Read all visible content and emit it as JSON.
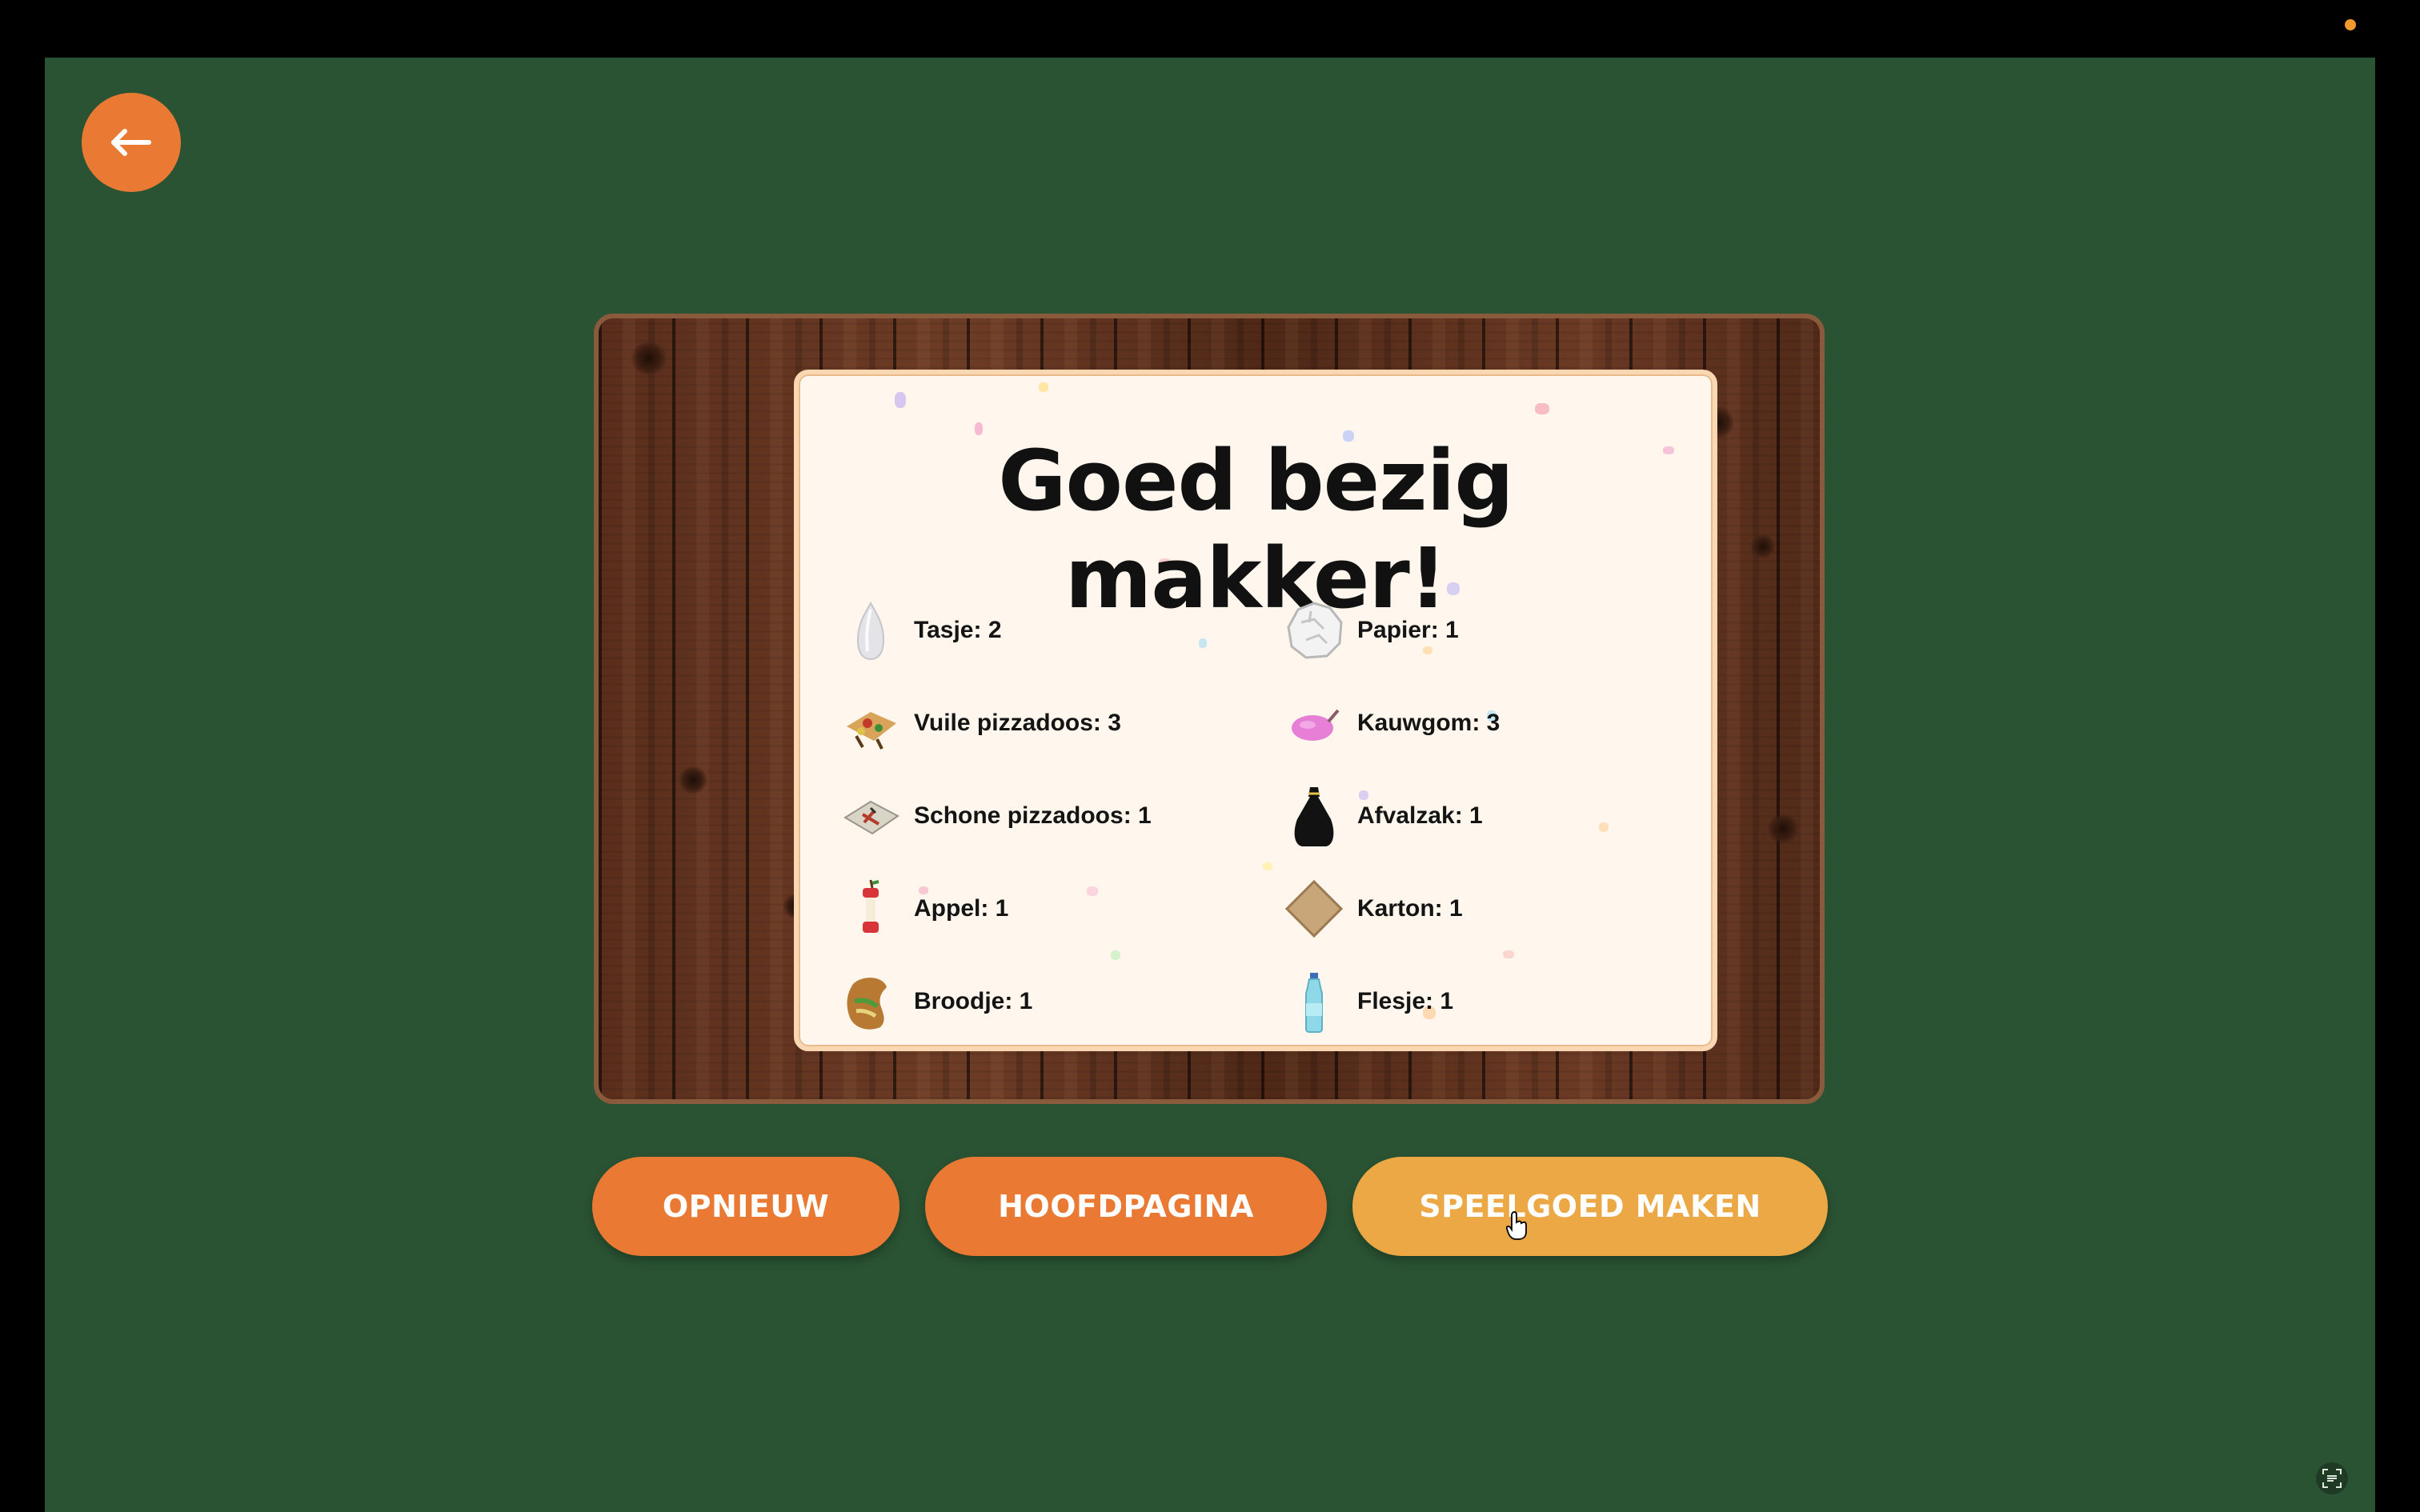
{
  "card": {
    "title": "Goed bezig makker!"
  },
  "items": [
    {
      "label": "Tasje: 2",
      "icon": "plastic-bag-icon"
    },
    {
      "label": "Papier: 1",
      "icon": "crumpled-paper-icon"
    },
    {
      "label": "Vuile pizzadoos: 3",
      "icon": "dirty-pizza-box-icon"
    },
    {
      "label": "Kauwgom: 3",
      "icon": "chewing-gum-icon"
    },
    {
      "label": "Schone pizzadoos: 1",
      "icon": "clean-pizza-box-icon"
    },
    {
      "label": "Afvalzak: 1",
      "icon": "trash-bag-icon"
    },
    {
      "label": "Appel: 1",
      "icon": "apple-core-icon"
    },
    {
      "label": "Karton: 1",
      "icon": "cardboard-icon"
    },
    {
      "label": "Broodje: 1",
      "icon": "sandwich-icon"
    },
    {
      "label": "Flesje: 1",
      "icon": "bottle-icon"
    }
  ],
  "buttons": {
    "retry": "OPNIEUW",
    "home": "HOOFDPAGINA",
    "make_toy": "SPEELGOED MAKEN"
  },
  "colors": {
    "background": "#2a5333",
    "button_primary": "#ea7a33",
    "button_highlight": "#eba844",
    "card": "#fff7ee"
  }
}
